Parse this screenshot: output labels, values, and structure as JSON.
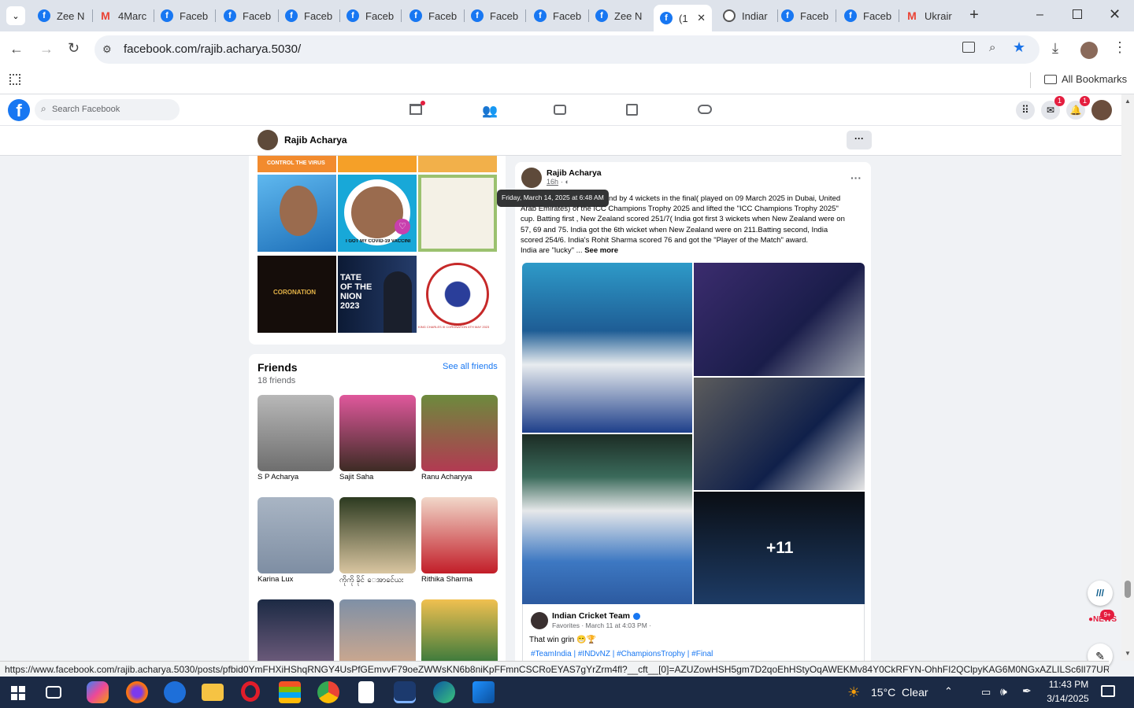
{
  "browser": {
    "tabs": [
      {
        "label": "Zee N",
        "icon": "facebook-icon"
      },
      {
        "label": "4Marc",
        "icon": "gmail-icon"
      },
      {
        "label": "Faceb",
        "icon": "facebook-icon"
      },
      {
        "label": "Faceb",
        "icon": "facebook-icon"
      },
      {
        "label": "Faceb",
        "icon": "facebook-icon"
      },
      {
        "label": "Faceb",
        "icon": "facebook-icon"
      },
      {
        "label": "Faceb",
        "icon": "facebook-icon"
      },
      {
        "label": "Faceb",
        "icon": "facebook-icon"
      },
      {
        "label": "Faceb",
        "icon": "facebook-icon"
      },
      {
        "label": "Zee N",
        "icon": "facebook-icon"
      },
      {
        "label": "(1",
        "icon": "facebook-icon"
      },
      {
        "label": "Indiar",
        "icon": "globe-icon"
      },
      {
        "label": "Faceb",
        "icon": "facebook-icon"
      },
      {
        "label": "Faceb",
        "icon": "facebook-icon"
      },
      {
        "label": "Ukrair",
        "icon": "gmail-icon"
      }
    ],
    "url": "facebook.com/rajib.acharya.5030/",
    "bookmarks_label": "All Bookmarks"
  },
  "facebook": {
    "search_placeholder": "Search Facebook",
    "messenger_badge": "1",
    "notifications_badge": "1",
    "profile_name": "Rajib Acharya",
    "friends": {
      "title": "Friends",
      "count": "18 friends",
      "see_all": "See all friends",
      "names": [
        "S P Acharya",
        "Sajit Saha",
        "Ranu Acharyya",
        "Karina Lux",
        "ကိုကို ခိုင် ေအာင်ေယး",
        "Rithika Sharma"
      ]
    },
    "photos": {
      "photo_text_1": "CONTROL THE VIRUS",
      "photo_text_2": "I GOT MY COVID-19 VACCINE",
      "photo_text_3": "CORONATION",
      "photo_text_4": "TATE OF THE NION 2023",
      "photo_text_5": "KING CHARLES III CORONATION 6TH MAY 2023"
    },
    "post": {
      "author": "Rajib Acharya",
      "time": "16h",
      "tooltip": "Friday, March 14, 2025 at 6:48 AM",
      "text_line1": "nd by 4 wickets in the final( played on 09 March 2025 in Dubai, United",
      "text_line2": "Arab Emirates) of the ICC Champions Trophy 2025  and lifted the \"ICC Champions Trophy 2025\"",
      "text_line3": "cup. Batting first , New Zealand scored 251/7( India got first 3 wickets when New Zealand were on",
      "text_line4": "57, 69 and 75. India got the 6th wicket when New Zealand were on 211.Batting second, India",
      "text_line5": "scored 254/6. India's Rohit Sharma scored 76 and got the \"Player of the Match\" award.",
      "text_line6": "India are \"lucky\" ... ",
      "see_more": "See more",
      "more_photos": "+11",
      "shared_page": "Indian Cricket Team",
      "shared_meta": "Favorites · March 11 at 4:03 PM ·",
      "shared_text": "That win grin 😁🏆",
      "hashtags": "#TeamIndia | #INDvNZ | #ChampionsTrophy | #Final"
    },
    "news_badge": "9+"
  },
  "status_url": "https://www.facebook.com/rajib.acharya.5030/posts/pfbid0YmFHXiHShqRNGY4UsPfGEmvvF79oeZWWsKN6b8niKpFFmnCSCRoEYAS7gYrZrm4fl?__cft__[0]=AZUZowHSH5gm7D2qoEhHStyOqAWEKMv84Y0CkRFYN-OhhFI2QClpyKAG6M0NGxAZLILSc6lI77URiJQAbrX1...",
  "taskbar": {
    "weather": "15°C  Clear",
    "time": "11:43 PM",
    "date": "3/14/2025"
  },
  "colors": {
    "fb_blue": "#1877f2",
    "badge_red": "#e41e3f"
  }
}
